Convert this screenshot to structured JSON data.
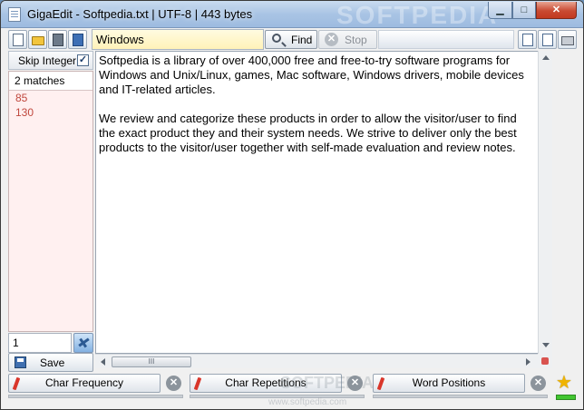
{
  "window": {
    "title": "GigaEdit - Softpedia.txt | UTF-8 | 443 bytes",
    "watermark": "SOFTPEDIA",
    "controls": {
      "minimize": "▁",
      "maximize": "□",
      "close": "✕"
    }
  },
  "toolbar": {
    "search_value": "Windows",
    "find_label": "Find",
    "stop_label": "Stop",
    "stop_glyph": "✕",
    "buttons": [
      "new-file-icon",
      "open-folder-icon",
      "save-icon",
      "save-as-icon",
      "document-icon",
      "document-settings-icon",
      "print-icon"
    ]
  },
  "sidebar": {
    "skip_integer_label": "Skip Integer",
    "skip_integer_checked": true,
    "check_glyph": "✓",
    "matches_label": "2 matches",
    "matches": [
      "85",
      "130"
    ],
    "line_number": "1",
    "save_label": "Save"
  },
  "editor": {
    "paragraphs": [
      "Softpedia is a library of over 400,000 free and free-to-try software programs for Windows and Unix/Linux, games, Mac software, Windows drivers, mobile devices and IT-related articles.",
      "We review and categorize these products in order to allow the visitor/user to find the exact product they and their system needs. We strive to deliver only the best products to the visitor/user together with self-made evaluation and review notes."
    ],
    "scroll_thumb_grip": "III"
  },
  "bottom_panels": [
    {
      "label": "Char Frequency"
    },
    {
      "label": "Char Repetitions"
    },
    {
      "label": "Word Positions"
    }
  ],
  "bottom": {
    "close_glyph": "✕",
    "star_glyph": "★",
    "watermark": "SOFTPEDIA",
    "watermark_url": "www.softpedia.com"
  },
  "colors": {
    "search_field": "#fff4c0",
    "results_bg": "#fff0f0",
    "match_text": "#c0483e",
    "progress_green": "#42c531"
  }
}
